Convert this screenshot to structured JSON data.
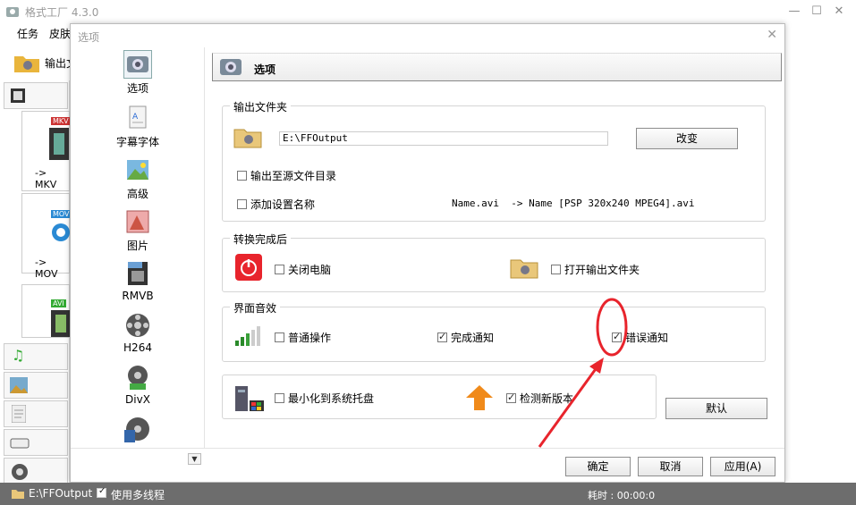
{
  "app": {
    "title": "格式工厂 4.3.0",
    "menu": [
      "任务",
      "皮肤"
    ],
    "toolbar_output_label": "输出文",
    "format_cards": [
      "-> MKV",
      "-> MOV",
      ""
    ],
    "card_badges": [
      "MKV",
      "MOV",
      "AVI"
    ]
  },
  "dialog": {
    "title": "选项",
    "header": "选项",
    "nav": [
      {
        "label": "选项",
        "icon": "settings-icon"
      },
      {
        "label": "字幕字体",
        "icon": "subtitle-font-icon"
      },
      {
        "label": "高级",
        "icon": "advanced-icon"
      },
      {
        "label": "图片",
        "icon": "picture-icon"
      },
      {
        "label": "RMVB",
        "icon": "rmvb-icon"
      },
      {
        "label": "H264",
        "icon": "h264-icon"
      },
      {
        "label": "DivX",
        "icon": "divx-icon"
      }
    ],
    "output": {
      "group_title": "输出文件夹",
      "path": "E:\\FFOutput",
      "change_button": "改变",
      "output_to_source": "输出至源文件目录",
      "add_setting_name": "添加设置名称",
      "name_example": "Name.avi  -> Name [PSP 320x240 MPEG4].avi"
    },
    "after_convert": {
      "group_title": "转换完成后",
      "shutdown": "关闭电脑",
      "open_folder": "打开输出文件夹"
    },
    "sound": {
      "group_title": "界面音效",
      "normal": "普通操作",
      "complete": "完成通知",
      "error": "错误通知"
    },
    "misc": {
      "minimize_tray": "最小化到系统托盘",
      "check_update": "检测新版本"
    },
    "buttons": {
      "default": "默认",
      "ok": "确定",
      "cancel": "取消",
      "apply": "应用(A)"
    }
  },
  "status": {
    "path": "E:\\FFOutput",
    "multithread": "使用多线程",
    "elapsed": "耗时 : 00:00:0"
  },
  "colors": {
    "accent_red": "#e8242c",
    "status_bar": "#6d6d6d"
  }
}
